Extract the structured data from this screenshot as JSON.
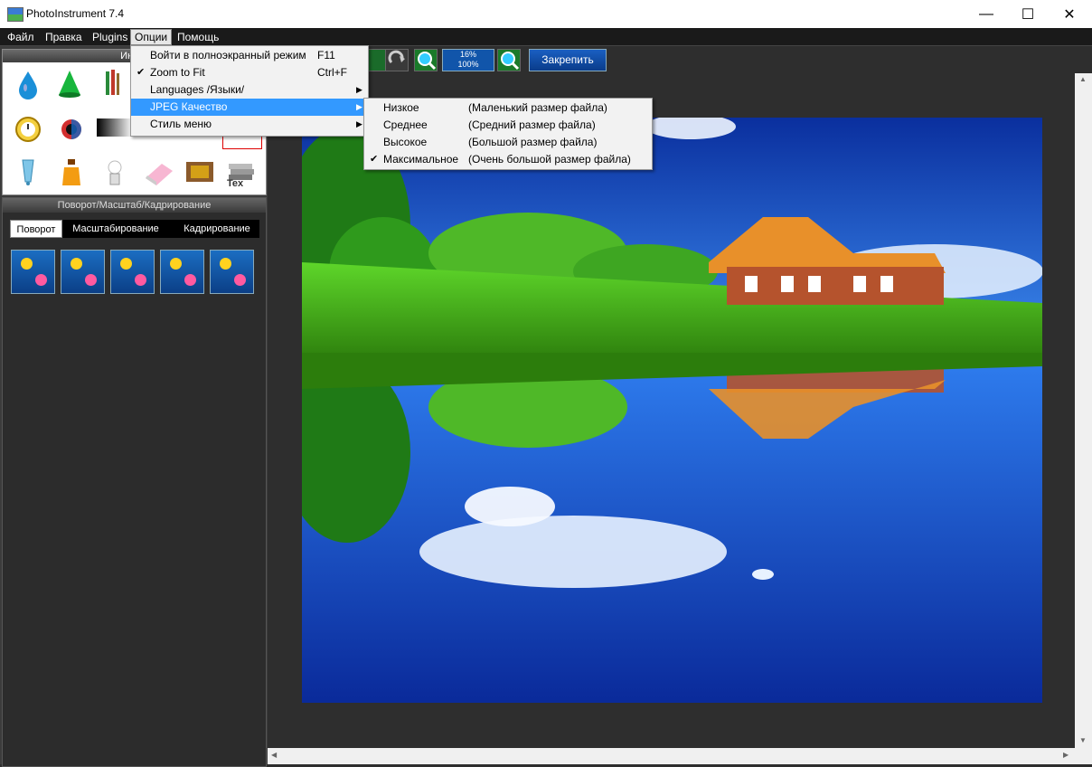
{
  "window": {
    "title": "PhotoInstrument 7.4",
    "minimize": "—",
    "maximize": "☐",
    "close": "✕"
  },
  "menubar": [
    "Файл",
    "Правка",
    "Plugins",
    "Опции",
    "Помощь"
  ],
  "tools_panel": {
    "title": "Инстр"
  },
  "rotate_panel": {
    "title": "Поворот/Масштаб/Кадрирование",
    "tabs": [
      "Поворот",
      "Масштабирование",
      "Кадрирование"
    ]
  },
  "toolbar": {
    "zoom_top": "16%",
    "zoom_bottom": "100%",
    "pin_label": "Закрепить"
  },
  "options_menu": [
    {
      "label": "Войти в полноэкранный режим",
      "shortcut": "F11",
      "checked": false
    },
    {
      "label": "Zoom to Fit",
      "shortcut": "Ctrl+F",
      "checked": true
    },
    {
      "label": "Languages /Языки/",
      "shortcut": "",
      "submenu": true
    },
    {
      "label": "JPEG Качество",
      "shortcut": "",
      "submenu": true
    },
    {
      "label": "Стиль меню",
      "shortcut": "",
      "submenu": true
    }
  ],
  "jpeg_submenu": [
    {
      "label": "Низкое",
      "desc": "(Маленький размер файла)"
    },
    {
      "label": "Среднее",
      "desc": "(Средний размер файла)"
    },
    {
      "label": "Высокое",
      "desc": "(Большой размер файла)"
    },
    {
      "label": "Максимальное",
      "desc": "(Очень большой размер файла)"
    }
  ],
  "checkmark": "✔",
  "arrow": "▶",
  "scroll_arrows": {
    "up": "▲",
    "down": "▼",
    "left": "◀",
    "right": "▶"
  },
  "tools_text_icon": "Tex",
  "colors": {
    "accent": "#3399ff",
    "menubar": "#1a1a1a",
    "panel": "#3c3c3c"
  }
}
